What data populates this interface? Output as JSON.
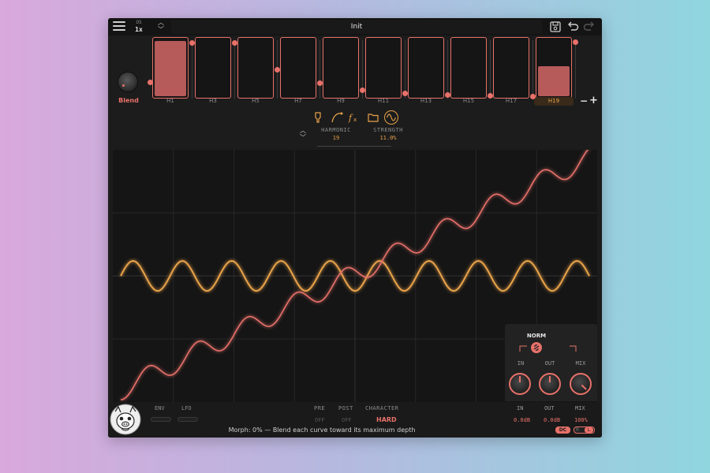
{
  "toolbar": {
    "os_label": "OS",
    "os_value": "1x",
    "preset_name": "Init",
    "icons": [
      "menu-icon",
      "save-icon",
      "undo-icon",
      "redo-icon"
    ]
  },
  "harmonics": {
    "blend_label": "Blend",
    "bars": [
      {
        "label": "H1",
        "level": 0.95,
        "active": false
      },
      {
        "label": "H3",
        "level": 0,
        "active": false
      },
      {
        "label": "H5",
        "level": 0,
        "active": false
      },
      {
        "label": "H7",
        "level": 0,
        "active": false
      },
      {
        "label": "H9",
        "level": 0,
        "active": false
      },
      {
        "label": "H11",
        "level": 0,
        "active": false
      },
      {
        "label": "H13",
        "level": 0,
        "active": false
      },
      {
        "label": "H15",
        "level": 0,
        "active": false
      },
      {
        "label": "H17",
        "level": 0,
        "active": false
      },
      {
        "label": "H19",
        "level": 0.52,
        "active": true
      }
    ],
    "minus_label": "−",
    "plus_label": "+"
  },
  "tools": {
    "icons": [
      "pin-icon",
      "curve-icon",
      "fx-icon",
      "folder-icon",
      "sine-wave-icon"
    ],
    "harmonic_label": "HARMONIC",
    "harmonic_value": "19",
    "strength_label": "STRENGTH",
    "strength_value": "11.0%"
  },
  "graph": {
    "curve_colors": {
      "transfer": "#e8716a",
      "sine": "#e8a24a"
    }
  },
  "norm": {
    "title": "NORM",
    "in_label": "IN",
    "out_label": "OUT",
    "mix_label": "MIX"
  },
  "bottom": {
    "env_label": "ENV",
    "lfo_label": "LFO",
    "pre_label": "PRE",
    "pre_value": "OFF",
    "post_label": "POST",
    "post_value": "OFF",
    "character_label": "CHARACTER",
    "character_value": "HARD",
    "in_label": "IN",
    "in_value": "0.0dB",
    "out_label": "OUT",
    "out_value": "0.0dB",
    "mix_label": "MIX",
    "mix_value": "100%",
    "status": "Morph: 0%  —  Blend each curve toward its maximum depth",
    "dc_label": "DC",
    "r_label": "R",
    "l_label": "L"
  },
  "colors": {
    "accent": "#e8716a",
    "secondary": "#e8a24a",
    "panel": "#1c1c1c"
  }
}
